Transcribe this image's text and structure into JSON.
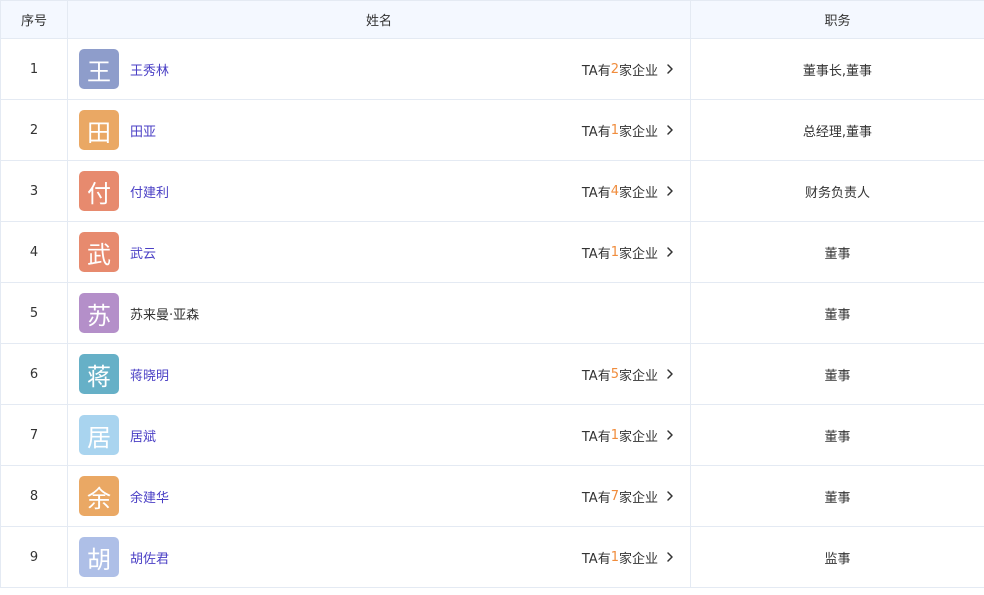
{
  "header": {
    "index": "序号",
    "name": "姓名",
    "role": "职务"
  },
  "company_prefix": "TA有",
  "company_suffix": "家企业",
  "rows": [
    {
      "index": "1",
      "avatar_char": "王",
      "avatar_color": "#8e9dcb",
      "name": "王秀林",
      "linked": true,
      "company_count": "2",
      "role": "董事长,董事"
    },
    {
      "index": "2",
      "avatar_char": "田",
      "avatar_color": "#eaa864",
      "name": "田亚",
      "linked": true,
      "company_count": "1",
      "role": "总经理,董事"
    },
    {
      "index": "3",
      "avatar_char": "付",
      "avatar_color": "#e78a6e",
      "name": "付建利",
      "linked": true,
      "company_count": "4",
      "role": "财务负责人"
    },
    {
      "index": "4",
      "avatar_char": "武",
      "avatar_color": "#e78a6e",
      "name": "武云",
      "linked": true,
      "company_count": "1",
      "role": "董事"
    },
    {
      "index": "5",
      "avatar_char": "苏",
      "avatar_color": "#b48fc9",
      "name": "苏来曼·亚森",
      "linked": false,
      "company_count": "",
      "role": "董事"
    },
    {
      "index": "6",
      "avatar_char": "蒋",
      "avatar_color": "#66b0c7",
      "name": "蒋晓明",
      "linked": true,
      "company_count": "5",
      "role": "董事"
    },
    {
      "index": "7",
      "avatar_char": "居",
      "avatar_color": "#a9d4ef",
      "name": "居斌",
      "linked": true,
      "company_count": "1",
      "role": "董事"
    },
    {
      "index": "8",
      "avatar_char": "余",
      "avatar_color": "#eaa864",
      "name": "余建华",
      "linked": true,
      "company_count": "7",
      "role": "董事"
    },
    {
      "index": "9",
      "avatar_char": "胡",
      "avatar_color": "#aebfe7",
      "name": "胡佐君",
      "linked": true,
      "company_count": "1",
      "role": "监事"
    }
  ]
}
